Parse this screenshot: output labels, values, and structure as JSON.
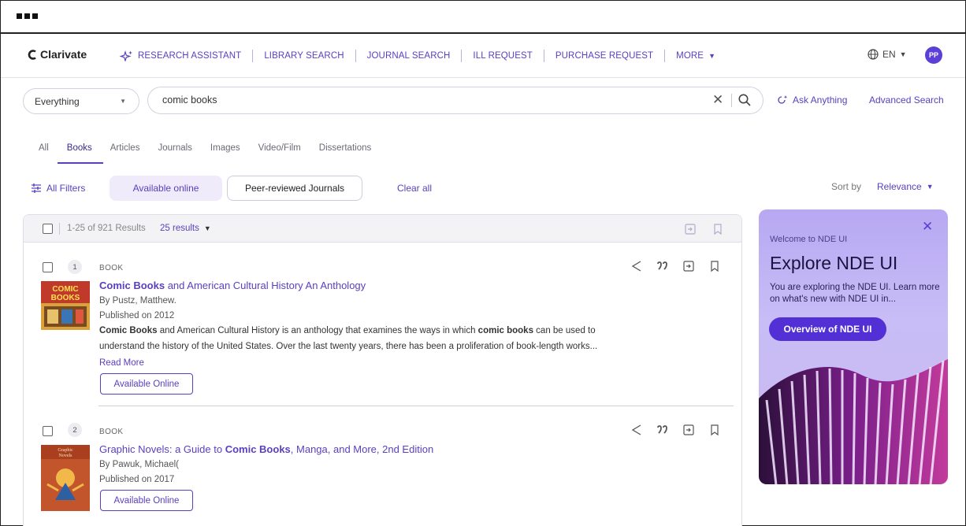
{
  "window": {
    "controls_icon": "three-dots-icon"
  },
  "nav": {
    "logo": "Clarivate",
    "items": [
      {
        "label": "RESEARCH ASSISTANT",
        "icon": "sparkle-icon"
      },
      {
        "label": "LIBRARY SEARCH"
      },
      {
        "label": "JOURNAL SEARCH"
      },
      {
        "label": "ILL REQUEST"
      },
      {
        "label": "PURCHASE REQUEST"
      },
      {
        "label": "MORE",
        "icon": "caret-down-icon"
      }
    ],
    "language": "EN",
    "avatar_initials": "PP"
  },
  "search": {
    "scope": "Everything",
    "query": "comic books",
    "ask_label": "Ask Anything",
    "advanced_label": "Advanced Search"
  },
  "tabs": [
    "All",
    "Books",
    "Articles",
    "Journals",
    "Images",
    "Video/Film",
    "Dissertations"
  ],
  "active_tab": "Books",
  "filters": {
    "all_filters": "All Filters",
    "chips": [
      "Available online",
      "Peer-reviewed Journals"
    ],
    "clear_all": "Clear all",
    "sort_label": "Sort by",
    "sort_value": "Relevance"
  },
  "results_header": {
    "count": "1-25 of 921 Results",
    "per_page": "25 results"
  },
  "results": [
    {
      "number": "1",
      "type": "BOOK",
      "title_bold": "Comic Books",
      "title_rest": " and American Cultural History An Anthology",
      "author": "By  Pustz, Matthew.",
      "published_label": "Published on ",
      "published_year": "2012",
      "desc_line1_a": "Comic Books",
      "desc_line1_b": " and American Cultural History is an anthology that examines the ways in which ",
      "desc_line1_c": "comic books",
      "desc_line1_d": " can be used to",
      "desc_line2": "understand the history of the United States. Over the last twenty years, there has been a proliferation of book-length works...",
      "read_more": "Read More",
      "availability": "Available Online",
      "thumb_text": "COMIC BOOKS"
    },
    {
      "number": "2",
      "type": "BOOK",
      "title_pre": "Graphic Novels: a Guide to ",
      "title_bold": "Comic Books",
      "title_rest": ", Manga, and More, 2nd Edition",
      "author": "By  Pawuk, Michael(",
      "published_label": "Published on ",
      "published_year": "2017",
      "availability": "Available Online",
      "thumb_text": "Graphic Novels"
    }
  ],
  "promo": {
    "welcome": "Welcome to NDE UI",
    "title": "Explore NDE UI",
    "description": "You are exploring the NDE UI. Learn more on what's new with NDE UI in...",
    "button": "Overview of NDE UI"
  },
  "colors": {
    "accent": "#5a3fc0",
    "brand_button": "#5230d6",
    "promo_bg": "#c3b6f4"
  }
}
